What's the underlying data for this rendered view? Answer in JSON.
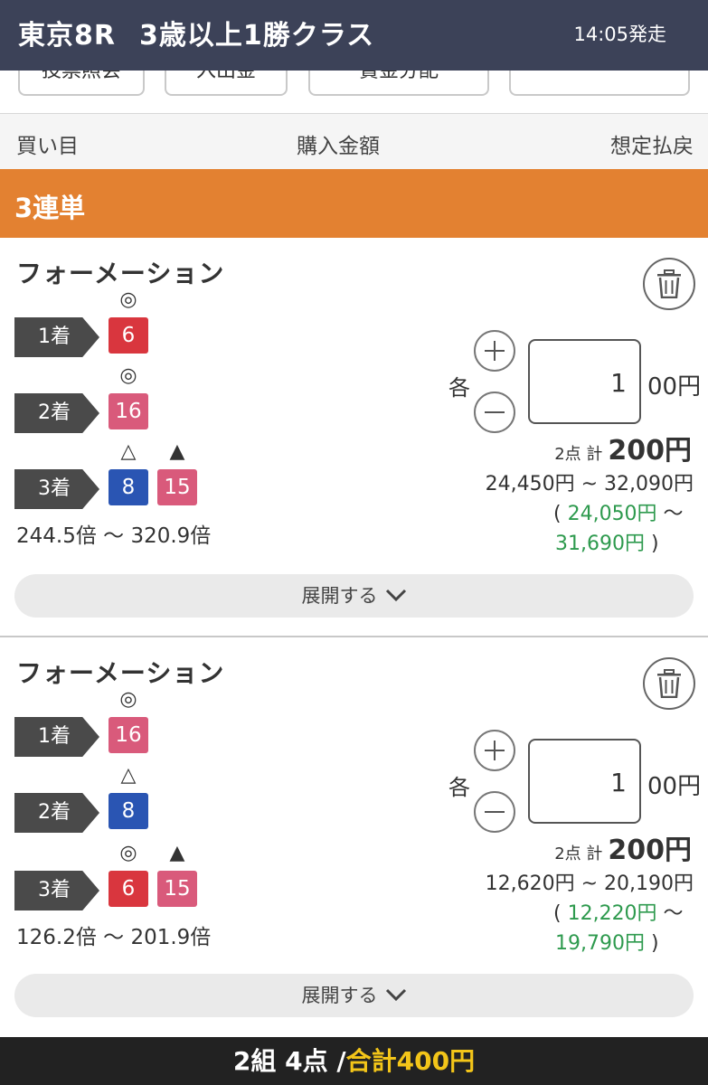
{
  "header": {
    "race": "東京8R",
    "class_name": "3歳以上1勝クラス",
    "post_time": "14:05発走"
  },
  "tabs": [
    "投票照会",
    "入出金",
    "賞金分配",
    ""
  ],
  "column_headers": {
    "bet": "買い目",
    "amount": "購入金額",
    "payout": "想定払戻"
  },
  "section": {
    "title": "3連単"
  },
  "cards": [
    {
      "type": "フォーメーション",
      "places": [
        {
          "label": "1着",
          "horses": [
            {
              "num": "6",
              "mark": "◎",
              "color": "#d9363e"
            }
          ]
        },
        {
          "label": "2着",
          "horses": [
            {
              "num": "16",
              "mark": "◎",
              "color": "#d95a7b"
            }
          ]
        },
        {
          "label": "3着",
          "horses": [
            {
              "num": "8",
              "mark": "△",
              "color": "#2a55b3"
            },
            {
              "num": "15",
              "mark": "▲",
              "color": "#d95a7b"
            }
          ]
        }
      ],
      "odds": "244.5倍 〜 320.9倍",
      "each_label": "各",
      "amount": "1",
      "unit": "00円",
      "points": "2点 計",
      "total": "200円",
      "payout_range": "24,450円 ~ 32,090円",
      "payout_green_min": "24,050円",
      "payout_green_max": "31,690円",
      "expand": "展開する"
    },
    {
      "type": "フォーメーション",
      "places": [
        {
          "label": "1着",
          "horses": [
            {
              "num": "16",
              "mark": "◎",
              "color": "#d95a7b"
            }
          ]
        },
        {
          "label": "2着",
          "horses": [
            {
              "num": "8",
              "mark": "△",
              "color": "#2a55b3"
            }
          ]
        },
        {
          "label": "3着",
          "horses": [
            {
              "num": "6",
              "mark": "◎",
              "color": "#d9363e"
            },
            {
              "num": "15",
              "mark": "▲",
              "color": "#d95a7b"
            }
          ]
        }
      ],
      "odds": "126.2倍 〜 201.9倍",
      "each_label": "各",
      "amount": "1",
      "unit": "00円",
      "points": "2点 計",
      "total": "200円",
      "payout_range": "12,620円 ~ 20,190円",
      "payout_green_min": "12,220円",
      "payout_green_max": "19,790円",
      "expand": "展開する"
    }
  ],
  "footer": {
    "summary": "2組 4点 /",
    "total": "合計400円"
  },
  "colors": {
    "header_bg": "#3c4258",
    "section_bg": "#e38131",
    "footer_bg": "#222222",
    "footer_accent": "#f3c519",
    "payout_green": "#2e9a4e"
  }
}
